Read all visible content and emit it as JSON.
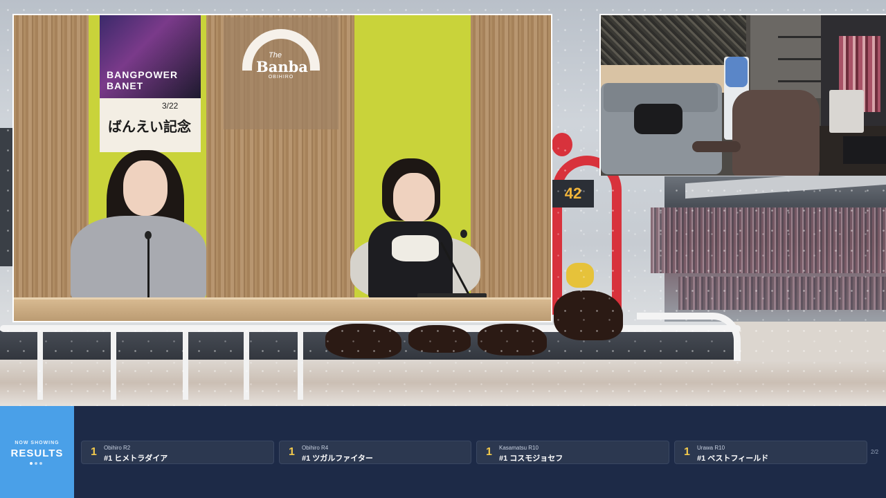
{
  "main_video": {
    "logo_the": "The",
    "logo_name": "Banba",
    "logo_sub": "OBIHIRO",
    "poster_title": "BANGPOWER BANET",
    "poster_date": "3/22",
    "poster_kanji": "ばんえい記念"
  },
  "scoreboard_text": "42",
  "ticker": {
    "label_small": "NOW SHOWING",
    "label_big": "RESULTS",
    "page_indicator": "2/2",
    "results": [
      {
        "rank": "1",
        "race": "Obihiro R2",
        "horse": "#1 ヒメトラダイア"
      },
      {
        "rank": "1",
        "race": "Obihiro R4",
        "horse": "#1 ツガルファイター"
      },
      {
        "rank": "1",
        "race": "Kasamatsu R10",
        "horse": "#1 コスモジョセフ"
      },
      {
        "rank": "1",
        "race": "Urawa R10",
        "horse": "#1 ベストフィールド"
      }
    ]
  },
  "colors": {
    "ticker_bg": "#1d2a47",
    "now_box": "#4aa0e8",
    "rank_gold": "#f2c94c"
  }
}
